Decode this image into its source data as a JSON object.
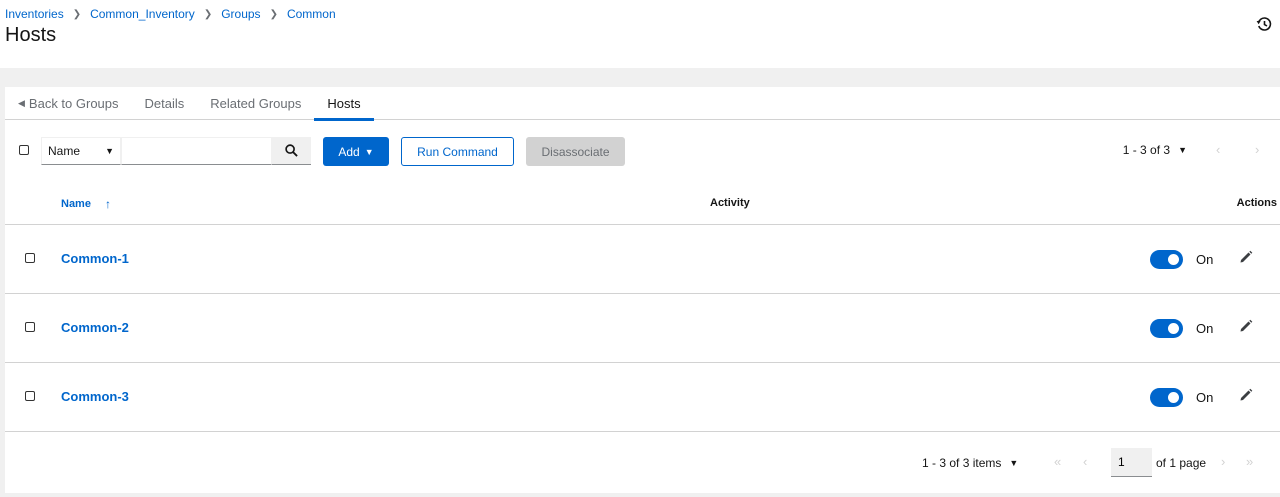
{
  "breadcrumb": [
    "Inventories",
    "Common_Inventory",
    "Groups",
    "Common"
  ],
  "page_title": "Hosts",
  "tabs": [
    {
      "label": "Back to Groups"
    },
    {
      "label": "Details"
    },
    {
      "label": "Related Groups"
    },
    {
      "label": "Hosts",
      "active": true
    }
  ],
  "toolbar": {
    "filter_select": "Name",
    "search_value": "",
    "add_label": "Add",
    "run_command_label": "Run Command",
    "disassociate_label": "Disassociate",
    "pagination": "1 - 3 of 3"
  },
  "table": {
    "headers": {
      "name": "Name",
      "activity": "Activity",
      "actions": "Actions"
    },
    "rows": [
      {
        "name": "Common-1",
        "toggle": "On"
      },
      {
        "name": "Common-2",
        "toggle": "On"
      },
      {
        "name": "Common-3",
        "toggle": "On"
      }
    ]
  },
  "footer": {
    "items_count": "1 - 3 of 3 items",
    "page_value": "1",
    "of_pages": "of 1 page"
  },
  "colors": {
    "accent": "#0066cc",
    "disabled": "#d2d2d2"
  }
}
